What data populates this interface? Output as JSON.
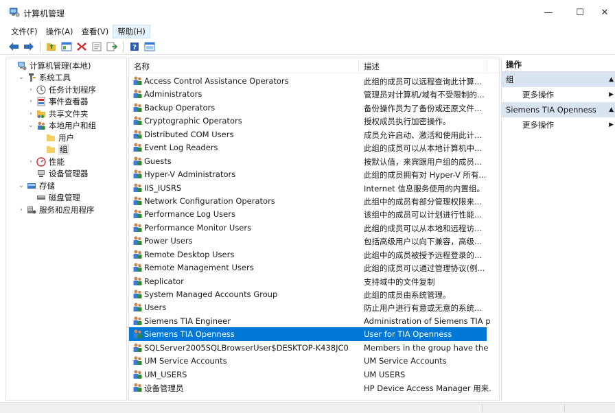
{
  "window": {
    "title": "计算机管理",
    "min_glyph": "—",
    "max_glyph": "☐",
    "close_glyph": "✕"
  },
  "menu": [
    "文件(F)",
    "操作(A)",
    "查看(V)",
    "帮助(H)"
  ],
  "toolbar": [
    "back-arrow-icon",
    "forward-arrow-icon",
    "up-folder-icon",
    "show-hide-tree-icon",
    "delete-icon",
    "properties-icon",
    "export-list-icon",
    "help-icon",
    "mmc-view-icon"
  ],
  "tree": [
    {
      "label": "计算机管理(本地)",
      "level": 0,
      "arrow": "",
      "icon": "computer-icon"
    },
    {
      "label": "系统工具",
      "level": 1,
      "arrow": "⌄",
      "icon": "tools-icon"
    },
    {
      "label": "任务计划程序",
      "level": 2,
      "arrow": "›",
      "icon": "clock-icon"
    },
    {
      "label": "事件查看器",
      "level": 2,
      "arrow": "›",
      "icon": "event-viewer-icon"
    },
    {
      "label": "共享文件夹",
      "level": 2,
      "arrow": "›",
      "icon": "shared-folder-icon"
    },
    {
      "label": "本地用户和组",
      "level": 2,
      "arrow": "⌄",
      "icon": "users-icon"
    },
    {
      "label": "用户",
      "level": 3,
      "arrow": "",
      "icon": "folder-icon"
    },
    {
      "label": "组",
      "level": 3,
      "arrow": "",
      "icon": "folder-icon",
      "selected": true
    },
    {
      "label": "性能",
      "level": 2,
      "arrow": "›",
      "icon": "performance-icon"
    },
    {
      "label": "设备管理器",
      "level": 2,
      "arrow": "",
      "icon": "device-manager-icon"
    },
    {
      "label": "存储",
      "level": 1,
      "arrow": "⌄",
      "icon": "storage-icon"
    },
    {
      "label": "磁盘管理",
      "level": 2,
      "arrow": "",
      "icon": "disk-icon"
    },
    {
      "label": "服务和应用程序",
      "level": 1,
      "arrow": "›",
      "icon": "services-icon"
    }
  ],
  "list": {
    "col_name": "名称",
    "col_desc": "描述",
    "rows": [
      {
        "name": "Access Control Assistance Operators",
        "desc": "此组的成员可以远程查询此计算..."
      },
      {
        "name": "Administrators",
        "desc": "管理员对计算机/域有不受限制的..."
      },
      {
        "name": "Backup Operators",
        "desc": "备份操作员为了备份或还原文件..."
      },
      {
        "name": "Cryptographic Operators",
        "desc": "授权成员执行加密操作。"
      },
      {
        "name": "Distributed COM Users",
        "desc": "成员允许启动、激活和使用此计..."
      },
      {
        "name": "Event Log Readers",
        "desc": "此组的成员可以从本地计算机中..."
      },
      {
        "name": "Guests",
        "desc": "按默认值，来宾跟用户组的成员..."
      },
      {
        "name": "Hyper-V Administrators",
        "desc": "此组的成员拥有对 Hyper-V 所有..."
      },
      {
        "name": "IIS_IUSRS",
        "desc": "Internet 信息服务使用的内置组。"
      },
      {
        "name": "Network Configuration Operators",
        "desc": "此组中的成员有部分管理权限来..."
      },
      {
        "name": "Performance Log Users",
        "desc": "该组中的成员可以计划进行性能..."
      },
      {
        "name": "Performance Monitor Users",
        "desc": "此组的成员可以从本地和远程访..."
      },
      {
        "name": "Power Users",
        "desc": "包括高级用户以向下兼容，高级..."
      },
      {
        "name": "Remote Desktop Users",
        "desc": "此组中的成员被授予远程登录的..."
      },
      {
        "name": "Remote Management Users",
        "desc": "此组的成员可以通过管理协议(例..."
      },
      {
        "name": "Replicator",
        "desc": "支持域中的文件复制"
      },
      {
        "name": "System Managed Accounts Group",
        "desc": "此组的成员由系统管理。"
      },
      {
        "name": "Users",
        "desc": "防止用户进行有意或无意的系统..."
      },
      {
        "name": "Siemens TIA Engineer",
        "desc": "Administration of Siemens TIA pr..."
      },
      {
        "name": "Siemens TIA Openness",
        "desc": "User for TIA Openness",
        "selected": true
      },
      {
        "name": "SQLServer2005SQLBrowserUser$DESKTOP-K438JC0",
        "desc": "Members in the group have the r..."
      },
      {
        "name": "UM Service Accounts",
        "desc": "UM Service Accounts"
      },
      {
        "name": "UM_USERS",
        "desc": "UM USERS"
      },
      {
        "name": "设备管理员",
        "desc": "HP Device Access Manager 用来..."
      }
    ]
  },
  "actions": {
    "title": "操作",
    "sections": [
      {
        "label": "组",
        "item": "更多操作"
      },
      {
        "label": "Siemens TIA Openness",
        "item": "更多操作"
      }
    ],
    "collapse_glyph": "▲",
    "more_glyph": "▶"
  },
  "colors": {
    "selection": "#0078d7",
    "section_bg": "#d8e4f0",
    "folder": "#f3cf63"
  }
}
